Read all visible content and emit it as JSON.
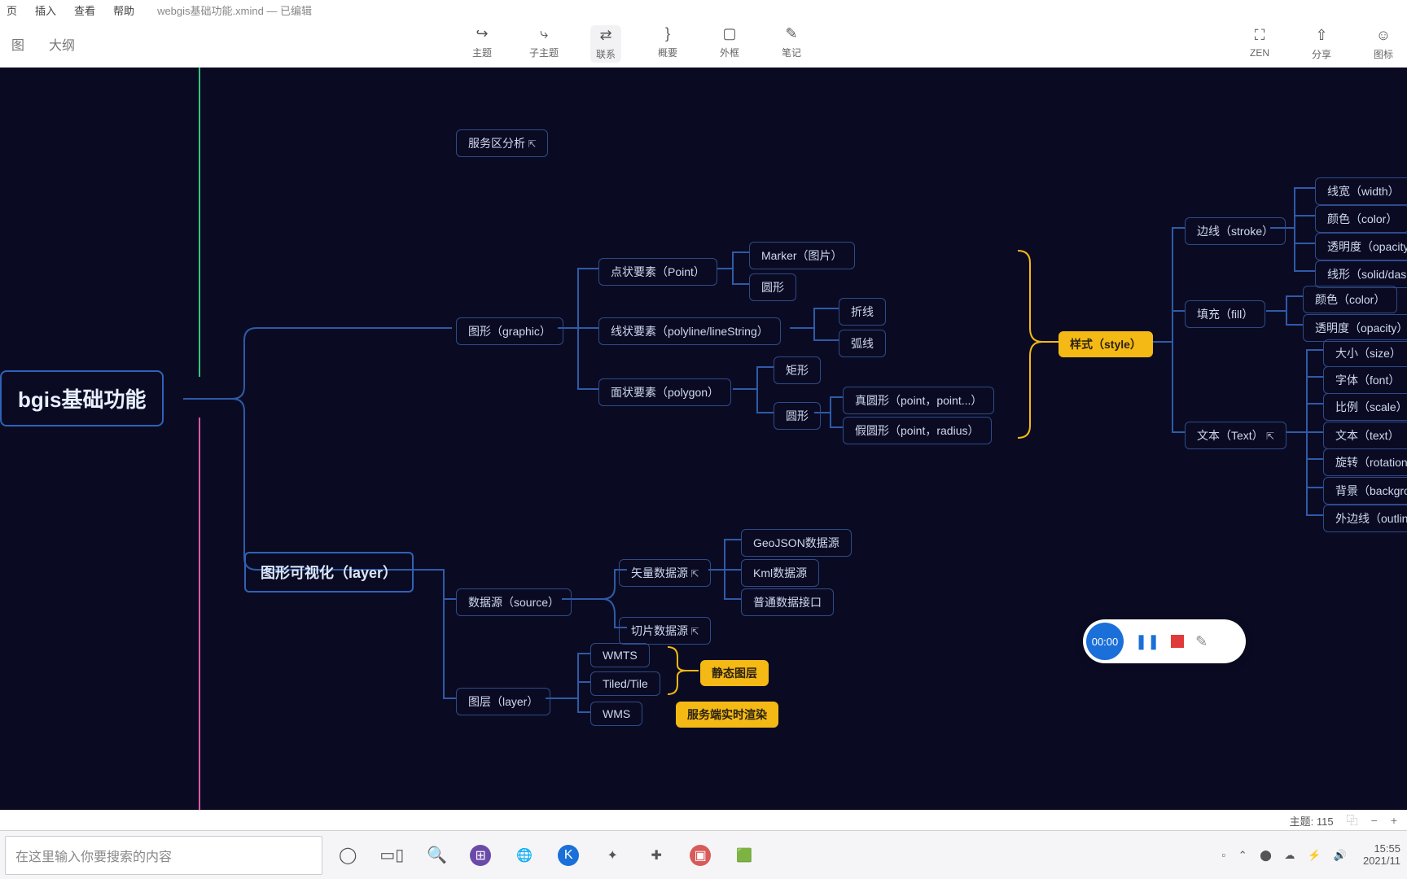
{
  "menu": {
    "m1": "页",
    "m2": "插入",
    "m3": "查看",
    "m4": "帮助",
    "doc": "webgis基础功能.xmind — 已编辑"
  },
  "tabs": {
    "main": "图",
    "outline": "大纲"
  },
  "tools": {
    "topic": "主题",
    "subtopic": "子主题",
    "relation": "联系",
    "summary": "概要",
    "boundary": "外框",
    "note": "笔记",
    "zen": "ZEN",
    "share": "分享",
    "emoji": "图标"
  },
  "nodes": {
    "root": "bgis基础功能",
    "service": "服务区分析",
    "graphic": "图形（graphic）",
    "point": "点状要素（Point）",
    "marker": "Marker（图片）",
    "circleShape": "圆形",
    "polyline": "线状要素（polyline/lineString）",
    "polyline1": "折线",
    "polyline2": "弧线",
    "polygon": "面状要素（polygon）",
    "rect": "矩形",
    "circleGroup": "圆形",
    "trueCircle": "真圆形（point，point...）",
    "fakeCircle": "假圆形（point，radius）",
    "style": "样式（style）",
    "stroke": "边线（stroke）",
    "s_width": "线宽（width）",
    "s_color": "颜色（color）",
    "s_opacity": "透明度（opacity",
    "s_dash": "线形（solid/das",
    "fill": "填充（fill）",
    "f_color": "颜色（color）",
    "f_opacity": "透明度（opacity）",
    "text": "文本（Text）",
    "t_size": "大小（size）",
    "t_font": "字体（font）",
    "t_scale": "比例（scale）",
    "t_text": "文本（text）",
    "t_rotate": "旋转（rotation",
    "t_bg": "背景（backgro",
    "t_outline": "外边线（outlin",
    "layerViz": "图形可视化（layer）",
    "source": "数据源（source）",
    "vecSource": "矢量数据源",
    "geojson": "GeoJSON数据源",
    "kml": "Kml数据源",
    "custom": "普通数据接口",
    "tileSource": "切片数据源",
    "layer": "图层（layer）",
    "wmts": "WMTS",
    "tiled": "Tiled/Tile",
    "wms": "WMS",
    "staticLayer": "静态图层",
    "serviceLayer": "服务端实时渲染"
  },
  "status": {
    "topics_label": "主题:",
    "topics_count": "115"
  },
  "search": {
    "placeholder": "在这里输入你要搜索的内容"
  },
  "recorder": {
    "time": "00:00"
  },
  "tray": {
    "time": "15:55",
    "date": "2021/11"
  }
}
